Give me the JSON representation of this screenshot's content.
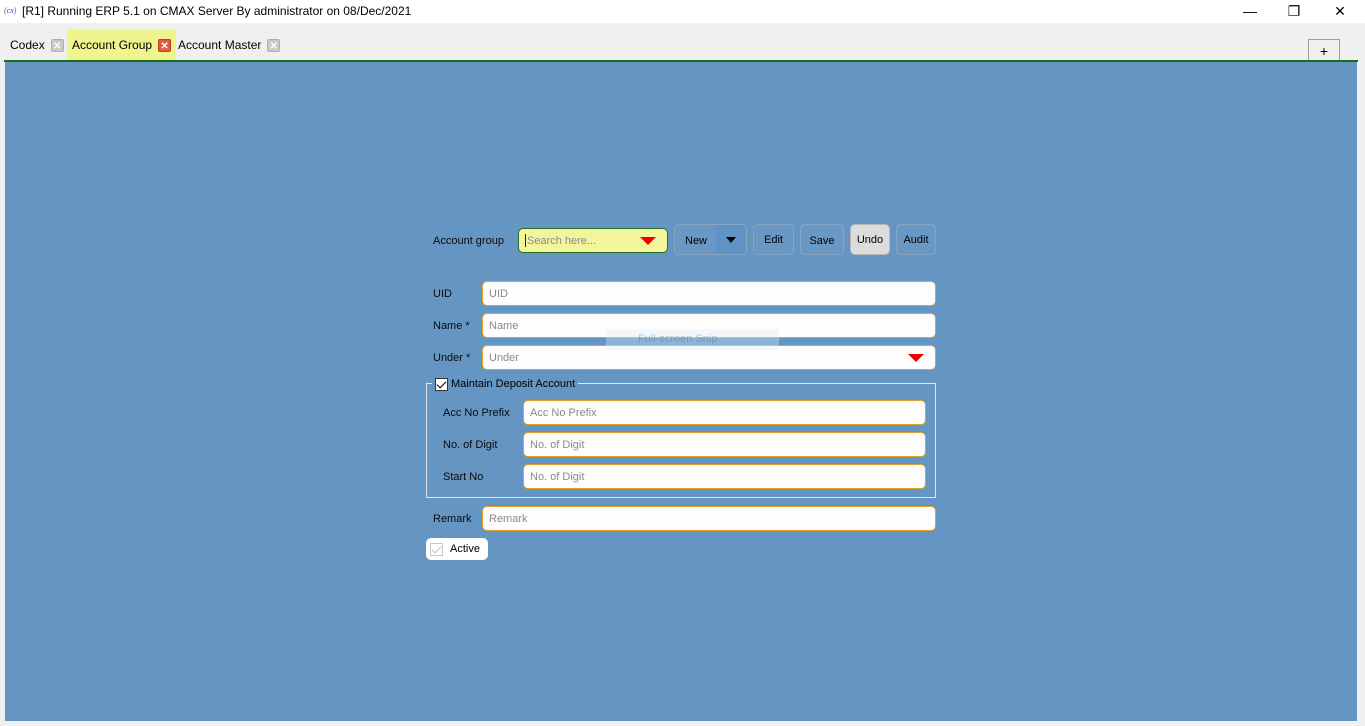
{
  "window": {
    "app_icon": "cx",
    "title": "[R1] Running ERP 5.1 on CMAX Server By administrator on 08/Dec/2021",
    "minimize_icon": "—",
    "restore_icon": "❐",
    "close_icon": "✕"
  },
  "tabs": [
    {
      "label": "Codex",
      "active": false
    },
    {
      "label": "Account Group",
      "active": true
    },
    {
      "label": "Account Master",
      "active": false
    }
  ],
  "tab_close_glyph": "✕",
  "add_tab_label": "+",
  "colors": {
    "panel_bg": "#6596c3",
    "active_tab_bg": "#f0f48c",
    "field_border": "#e2a22a",
    "search_bg": "#f2f59b",
    "accent_line": "#1d6b1a",
    "dropdown_arrow": "#f00000"
  },
  "toolbar": {
    "account_group_label": "Account group",
    "search_placeholder": "Search here...",
    "new_label": "New",
    "edit_label": "Edit",
    "save_label": "Save",
    "undo_label": "Undo",
    "audit_label": "Audit"
  },
  "form": {
    "uid": {
      "label": "UID",
      "placeholder": "UID",
      "value": ""
    },
    "name": {
      "label": "Name *",
      "placeholder": "Name",
      "value": ""
    },
    "under": {
      "label": "Under *",
      "placeholder": "Under",
      "value": ""
    },
    "deposit": {
      "label": "Maintain Deposit Account",
      "checked": true,
      "acc_no_prefix": {
        "label": "Acc No Prefix",
        "placeholder": "Acc No Prefix",
        "value": ""
      },
      "no_of_digit": {
        "label": "No. of Digit",
        "placeholder": "No. of Digit",
        "value": ""
      },
      "start_no": {
        "label": "Start No",
        "placeholder": "No. of Digit",
        "value": ""
      }
    },
    "remark": {
      "label": "Remark",
      "placeholder": "Remark",
      "value": ""
    },
    "active": {
      "label": "Active",
      "checked": true
    }
  },
  "overlay": {
    "snip_text": "Full-screen Snip"
  }
}
